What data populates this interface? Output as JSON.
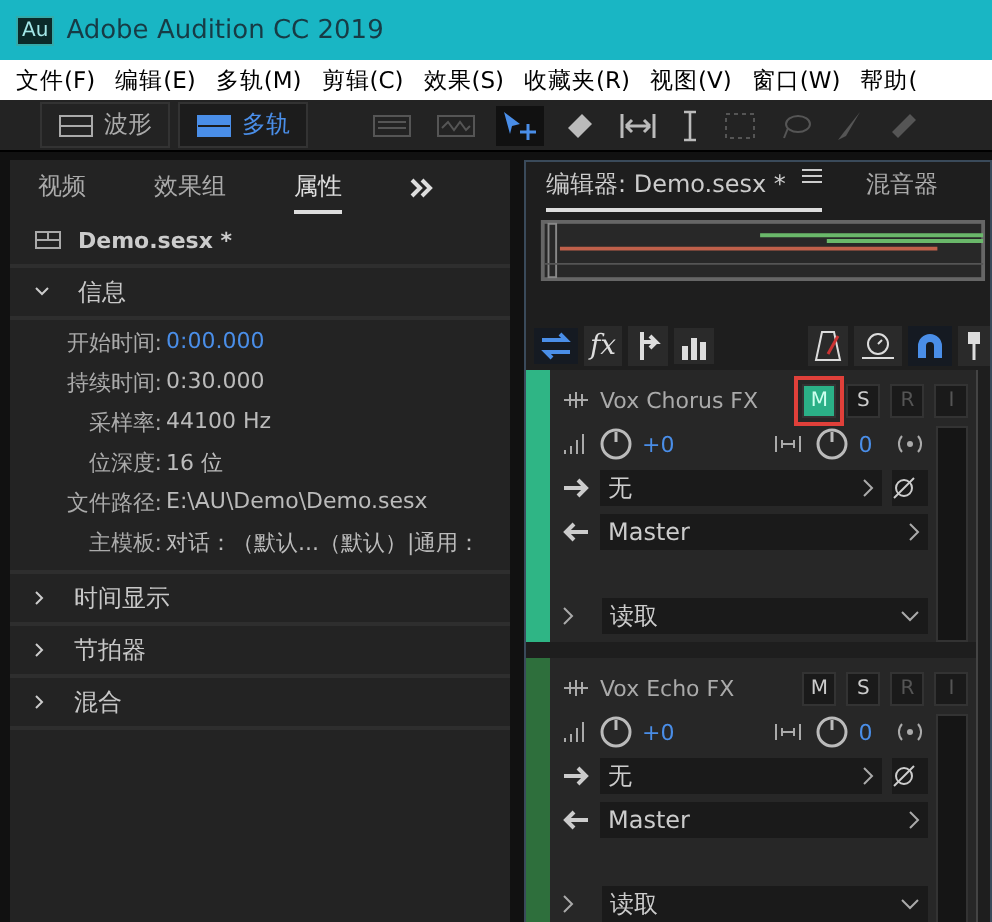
{
  "window": {
    "title": "Adobe Audition CC 2019",
    "app_icon": "Au"
  },
  "menu": [
    "文件(F)",
    "编辑(E)",
    "多轨(M)",
    "剪辑(C)",
    "效果(S)",
    "收藏夹(R)",
    "视图(V)",
    "窗口(W)",
    "帮助("
  ],
  "toolbar": {
    "modes": [
      {
        "label": "波形",
        "selected": false
      },
      {
        "label": "多轨",
        "selected": true
      }
    ],
    "tools": [
      {
        "kind": "spectral",
        "selected": false,
        "disabled": true
      },
      {
        "kind": "pitch",
        "selected": false,
        "disabled": true
      },
      {
        "kind": "move",
        "selected": true,
        "disabled": false
      },
      {
        "kind": "razor",
        "selected": false,
        "disabled": false
      },
      {
        "kind": "slip",
        "selected": false,
        "disabled": false
      },
      {
        "kind": "time",
        "selected": false,
        "disabled": false
      },
      {
        "kind": "marquee",
        "selected": false,
        "disabled": true
      },
      {
        "kind": "lasso",
        "selected": false,
        "disabled": true
      },
      {
        "kind": "brush",
        "selected": false,
        "disabled": true
      },
      {
        "kind": "heal",
        "selected": false,
        "disabled": true
      }
    ]
  },
  "left_panel": {
    "tabs": [
      {
        "label": "视频",
        "selected": false
      },
      {
        "label": "效果组",
        "selected": false
      },
      {
        "label": "属性",
        "selected": true
      }
    ],
    "file": "Demo.sesx *",
    "sections": [
      {
        "title": "信息",
        "expanded": true,
        "rows": [
          {
            "label": "开始时间:",
            "value": "0:00.000",
            "highlighted": true
          },
          {
            "label": "持续时间:",
            "value": "0:30.000",
            "highlighted": false
          },
          {
            "label": "采样率:",
            "value": "44100 Hz",
            "highlighted": false
          },
          {
            "label": "位深度:",
            "value": "16 位",
            "highlighted": false
          },
          {
            "label": "文件路径:",
            "value": "E:\\AU\\Demo\\Demo.sesx",
            "highlighted": false
          },
          {
            "label": "主模板:",
            "value": "对话：（默认...（默认）|通用：",
            "highlighted": false
          }
        ]
      },
      {
        "title": "时间显示",
        "expanded": false
      },
      {
        "title": "节拍器",
        "expanded": false
      },
      {
        "title": "混合",
        "expanded": false
      }
    ]
  },
  "editor": {
    "tabs": [
      {
        "label": "编辑器: Demo.sesx *",
        "selected": true
      },
      {
        "label": "混音器",
        "selected": false
      }
    ],
    "left_tools": [
      {
        "kind": "swap",
        "selected": true
      },
      {
        "kind": "fx",
        "selected": false
      },
      {
        "kind": "sends",
        "selected": false
      },
      {
        "kind": "eq",
        "selected": false
      }
    ],
    "right_tools": [
      {
        "kind": "metronome",
        "selected": false
      },
      {
        "kind": "timer",
        "selected": false
      },
      {
        "kind": "snap",
        "selected": true
      },
      {
        "kind": "pin",
        "selected": false
      }
    ],
    "tracks": [
      {
        "name": "Vox Chorus FX",
        "color": "#2fb585",
        "buttons": [
          {
            "label": "M",
            "on": true,
            "disabled": false,
            "highlighted": true
          },
          {
            "label": "S",
            "on": false,
            "disabled": false,
            "highlighted": false
          },
          {
            "label": "R",
            "on": false,
            "disabled": true,
            "highlighted": false
          },
          {
            "label": "I",
            "on": false,
            "disabled": true,
            "highlighted": false
          }
        ],
        "volume": "+0",
        "pan": "0",
        "input": "无",
        "output": "Master",
        "automation": "读取"
      },
      {
        "name": "Vox Echo FX",
        "color": "#2e6f3c",
        "buttons": [
          {
            "label": "M",
            "on": false,
            "disabled": false,
            "highlighted": false
          },
          {
            "label": "S",
            "on": false,
            "disabled": false,
            "highlighted": false
          },
          {
            "label": "R",
            "on": false,
            "disabled": true,
            "highlighted": false
          },
          {
            "label": "I",
            "on": false,
            "disabled": true,
            "highlighted": false
          }
        ],
        "volume": "+0",
        "pan": "0",
        "input": "无",
        "output": "Master",
        "automation": "读取"
      }
    ]
  }
}
